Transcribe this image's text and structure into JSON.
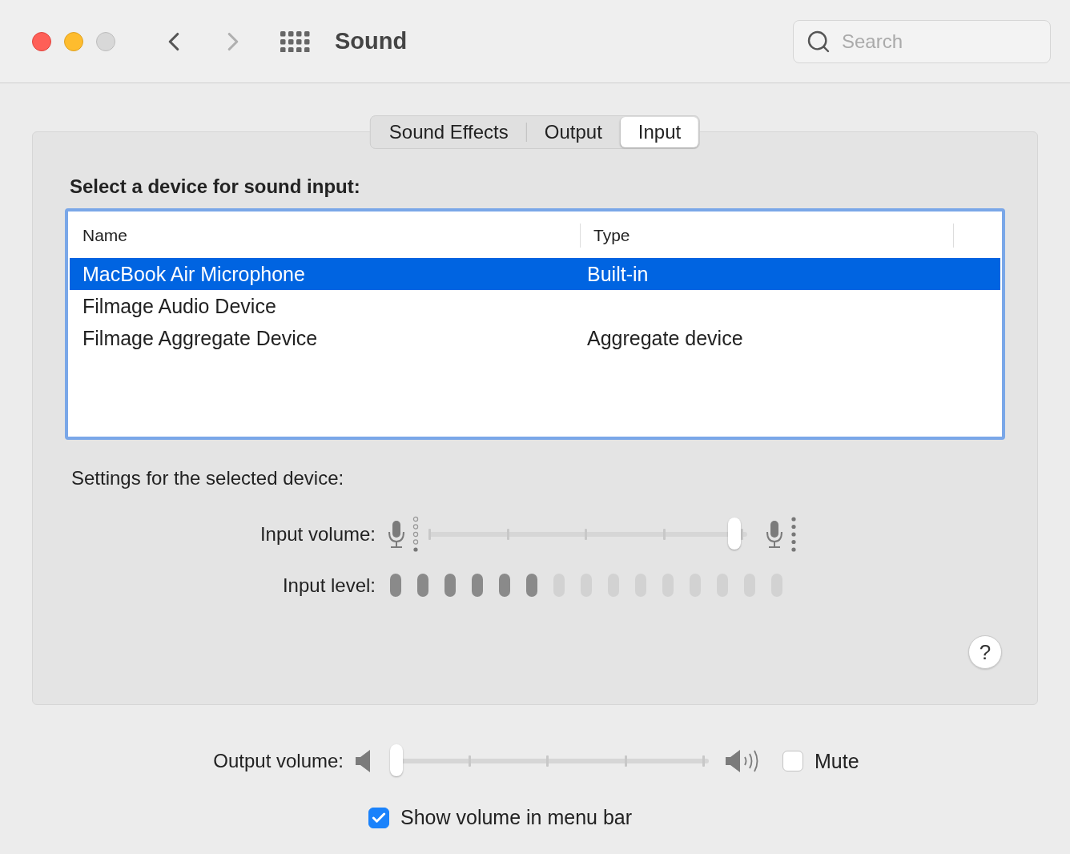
{
  "window": {
    "title": "Sound"
  },
  "navigation": {
    "back_disabled": false,
    "forward_disabled": true
  },
  "search": {
    "placeholder": "Search"
  },
  "tabs": [
    {
      "label": "Sound Effects",
      "selected": false
    },
    {
      "label": "Output",
      "selected": false
    },
    {
      "label": "Input",
      "selected": true
    }
  ],
  "device_list": {
    "heading": "Select a device for sound input:",
    "columns": [
      "Name",
      "Type"
    ],
    "rows": [
      {
        "name": "MacBook Air Microphone",
        "type": "Built-in",
        "selected": true
      },
      {
        "name": "Filmage Audio Device",
        "selected": false
      },
      {
        "name": "Filmage Aggregate Device",
        "type": "Aggregate device",
        "selected": false
      }
    ]
  },
  "settings_heading": "Settings for the selected device:",
  "input_volume": {
    "label": "Input volume:",
    "level": 0.98
  },
  "input_level": {
    "label": "Input level:",
    "level": 0.4
  },
  "help_button": {
    "label": "?"
  },
  "output_volume": {
    "label": "Output volume:",
    "level": 0,
    "mute": {
      "label": "Mute",
      "checked": false
    }
  },
  "show_volume": {
    "label": "Show volume in menu bar",
    "checked": true
  }
}
